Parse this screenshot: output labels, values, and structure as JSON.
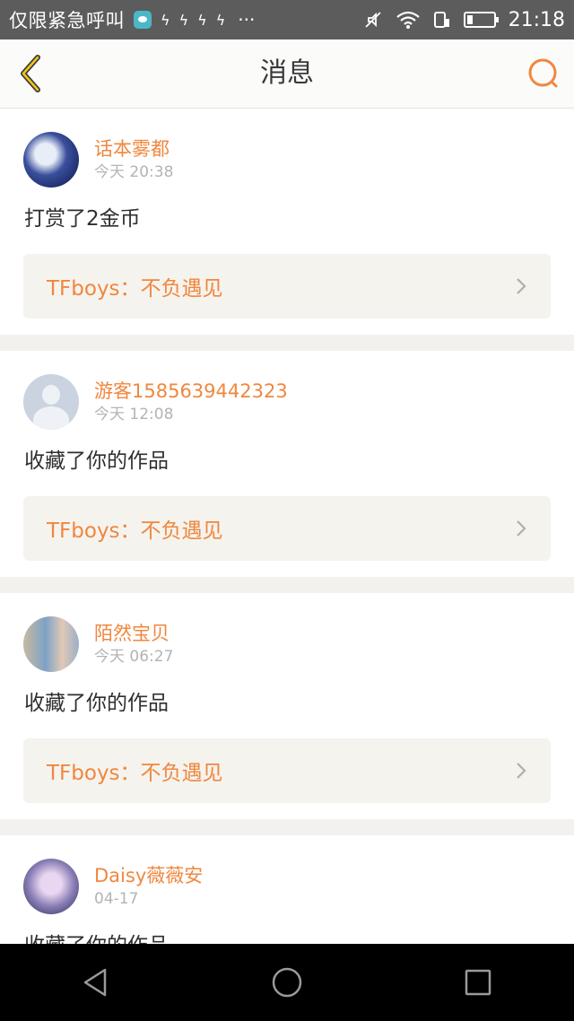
{
  "status_bar": {
    "carrier": "仅限紧急呼叫",
    "dots": "···",
    "time": "21:18"
  },
  "header": {
    "title": "消息",
    "back_icon": "back-chevron-icon",
    "search_icon": "search-icon"
  },
  "colors": {
    "accent": "#f0873e",
    "header_bg": "#fbfbfa",
    "page_bg": "#f2f1ee",
    "work_bg": "#f5f3ee"
  },
  "messages": [
    {
      "username": "话本雾都",
      "time": "今天 20:38",
      "action": "打赏了2金币",
      "work": "TFboys：不负遇见"
    },
    {
      "username": "游客1585639442323",
      "time": "今天 12:08",
      "action": "收藏了你的作品",
      "work": "TFboys：不负遇见"
    },
    {
      "username": "陌然宝贝",
      "time": "今天 06:27",
      "action": "收藏了你的作品",
      "work": "TFboys：不负遇见"
    },
    {
      "username": "Daisy薇薇安",
      "time": "04-17",
      "action": "收藏了你的作品",
      "work": ""
    }
  ],
  "nav": {
    "back": "nav-back-icon",
    "home": "nav-home-icon",
    "recents": "nav-recents-icon"
  }
}
